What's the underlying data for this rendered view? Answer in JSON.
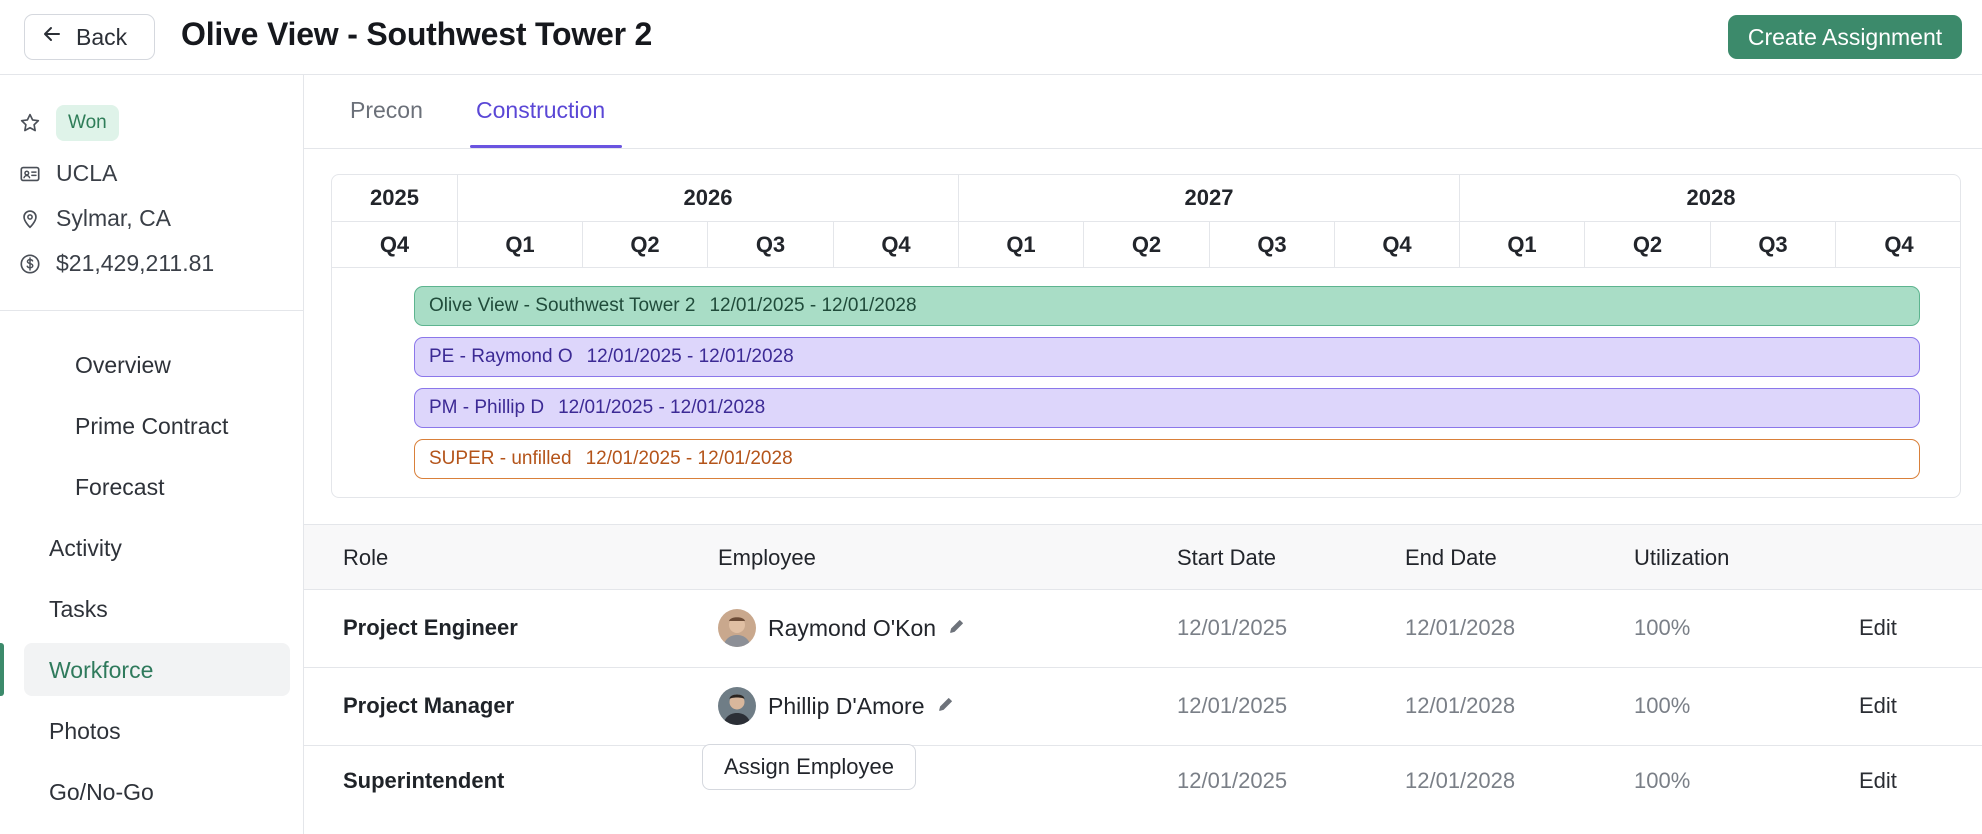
{
  "header": {
    "back_label": "Back",
    "title": "Olive View - Southwest Tower 2",
    "create_label": "Create Assignment"
  },
  "sidebar": {
    "status_badge": "Won",
    "client": "UCLA",
    "location": "Sylmar, CA",
    "value": "$21,429,211.81",
    "subitems": [
      {
        "label": "Overview"
      },
      {
        "label": "Prime Contract"
      },
      {
        "label": "Forecast"
      }
    ],
    "items": [
      {
        "label": "Activity"
      },
      {
        "label": "Tasks"
      },
      {
        "label": "Workforce",
        "active": true
      },
      {
        "label": "Photos"
      },
      {
        "label": "Go/No-Go"
      }
    ]
  },
  "tabs": [
    {
      "label": "Precon"
    },
    {
      "label": "Construction",
      "active": true
    }
  ],
  "gantt": {
    "years": [
      "2025",
      "2026",
      "2027",
      "2028"
    ],
    "quarters": [
      "Q4",
      "Q1",
      "Q2",
      "Q3",
      "Q4",
      "Q1",
      "Q2",
      "Q3",
      "Q4",
      "Q1",
      "Q2",
      "Q3",
      "Q4"
    ],
    "bars": [
      {
        "name": "Olive View - Southwest Tower 2",
        "dates": "12/01/2025 - 12/01/2028",
        "style": "project"
      },
      {
        "name": "PE - Raymond O",
        "dates": "12/01/2025 - 12/01/2028",
        "style": "filled"
      },
      {
        "name": "PM - Phillip D",
        "dates": "12/01/2025 - 12/01/2028",
        "style": "filled"
      },
      {
        "name": "SUPER - unfilled",
        "dates": "12/01/2025 - 12/01/2028",
        "style": "unfilled"
      }
    ]
  },
  "table": {
    "headers": {
      "role": "Role",
      "employee": "Employee",
      "start": "Start Date",
      "end": "End Date",
      "utilization": "Utilization"
    },
    "rows": [
      {
        "role": "Project Engineer",
        "employee": "Raymond O'Kon",
        "start": "12/01/2025",
        "end": "12/01/2028",
        "utilization": "100%",
        "action": "Edit"
      },
      {
        "role": "Project Manager",
        "employee": "Phillip D'Amore",
        "start": "12/01/2025",
        "end": "12/01/2028",
        "utilization": "100%",
        "action": "Edit"
      },
      {
        "role": "Superintendent",
        "assign_label": "Assign Employee",
        "start": "12/01/2025",
        "end": "12/01/2028",
        "utilization": "100%",
        "action": "Edit"
      }
    ]
  },
  "colors": {
    "accent_green": "#3c8a6b",
    "accent_purple": "#5a47d6",
    "bar_project": "#a9ddc6",
    "bar_filled": "#ddd6fb",
    "bar_unfilled_border": "#d9803a"
  }
}
